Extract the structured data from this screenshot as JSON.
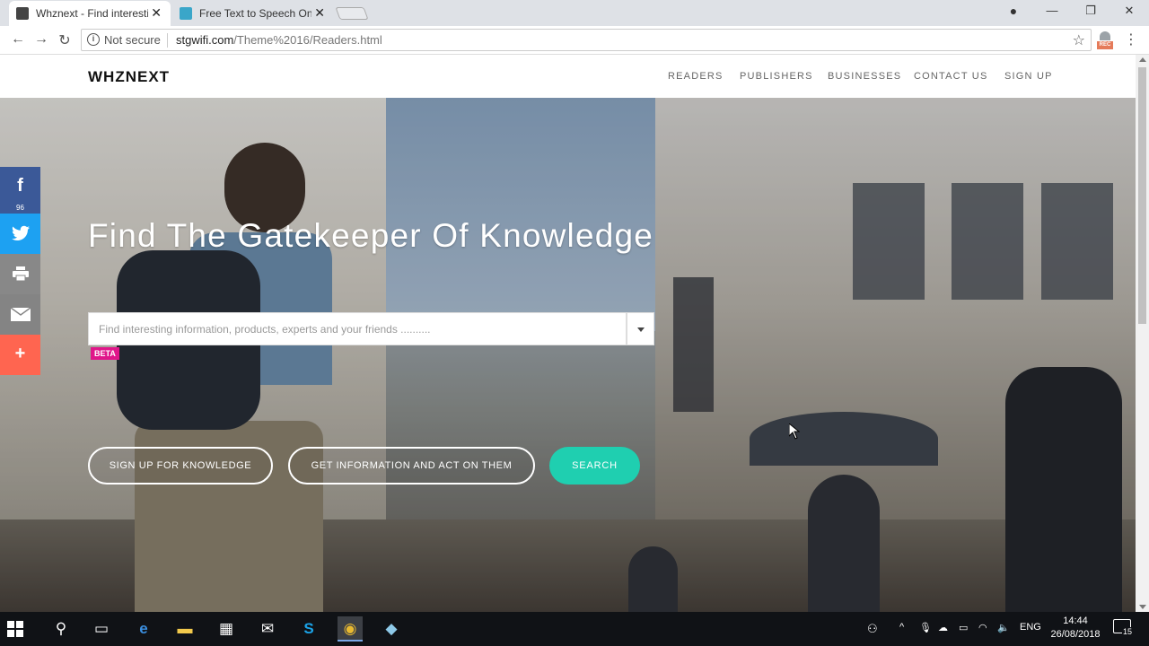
{
  "browser": {
    "tabs": [
      {
        "title": "Whznext - Find interesting",
        "active": true
      },
      {
        "title": "Free Text to Speech Onlin",
        "active": false
      }
    ],
    "address": {
      "security_label": "Not secure",
      "domain": "stgwifi.com",
      "path": "/Theme%2016/Readers.html"
    }
  },
  "site": {
    "logo": "WHZNEXT",
    "nav": [
      "READERS",
      "PUBLISHERS",
      "BUSINESSES",
      "CONTACT US",
      "SIGN UP"
    ]
  },
  "hero": {
    "headline": "Find The Gatekeeper Of Knowledge",
    "search_placeholder": "Find interesting information, products, experts and your friends ..........",
    "beta_badge": "BETA",
    "buttons": {
      "signup": "SIGN UP FOR KNOWLEDGE",
      "get_info": "GET INFORMATION AND ACT ON THEM",
      "search": "SEARCH"
    },
    "accent_color": "#1fcfb0"
  },
  "share_bar": {
    "facebook_count": "96",
    "icons": [
      "facebook-icon",
      "twitter-icon",
      "print-icon",
      "email-icon",
      "plus-icon"
    ]
  },
  "taskbar": {
    "language": "ENG",
    "time": "14:44",
    "date": "26/08/2018",
    "notification_count": "15"
  }
}
